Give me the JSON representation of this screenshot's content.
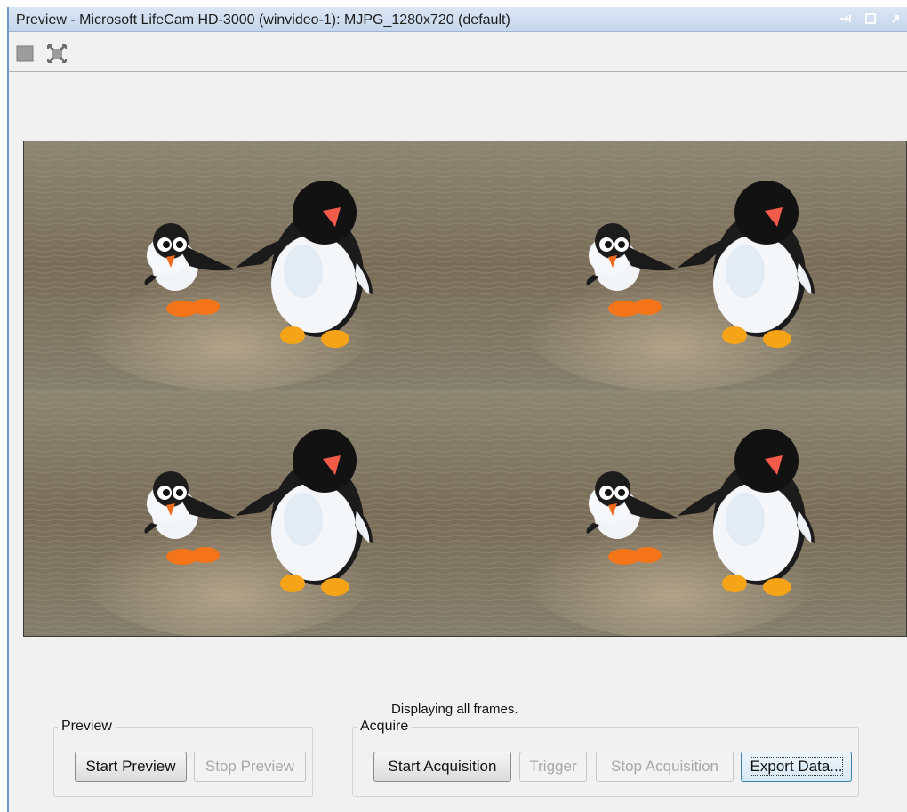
{
  "window": {
    "title": "Preview - Microsoft LifeCam HD-3000 (winvideo-1): MJPG_1280x720 (default)",
    "title_icons": [
      "undock-icon",
      "maximize-icon",
      "restore-icon"
    ],
    "accent_color": "#6f97c8"
  },
  "toolbar": {
    "items": [
      "stop-icon",
      "fit-to-window-icon"
    ]
  },
  "preview": {
    "image_description": "four-tile-penguin-preview",
    "status_text": "Displaying all frames."
  },
  "preview_group": {
    "legend": "Preview",
    "start_label": "Start Preview",
    "stop_label": "Stop Preview"
  },
  "acquire_group": {
    "legend": "Acquire",
    "start_label": "Start Acquisition",
    "trigger_label": "Trigger",
    "stop_label": "Stop Acquisition",
    "export_label": "Export Data..."
  }
}
